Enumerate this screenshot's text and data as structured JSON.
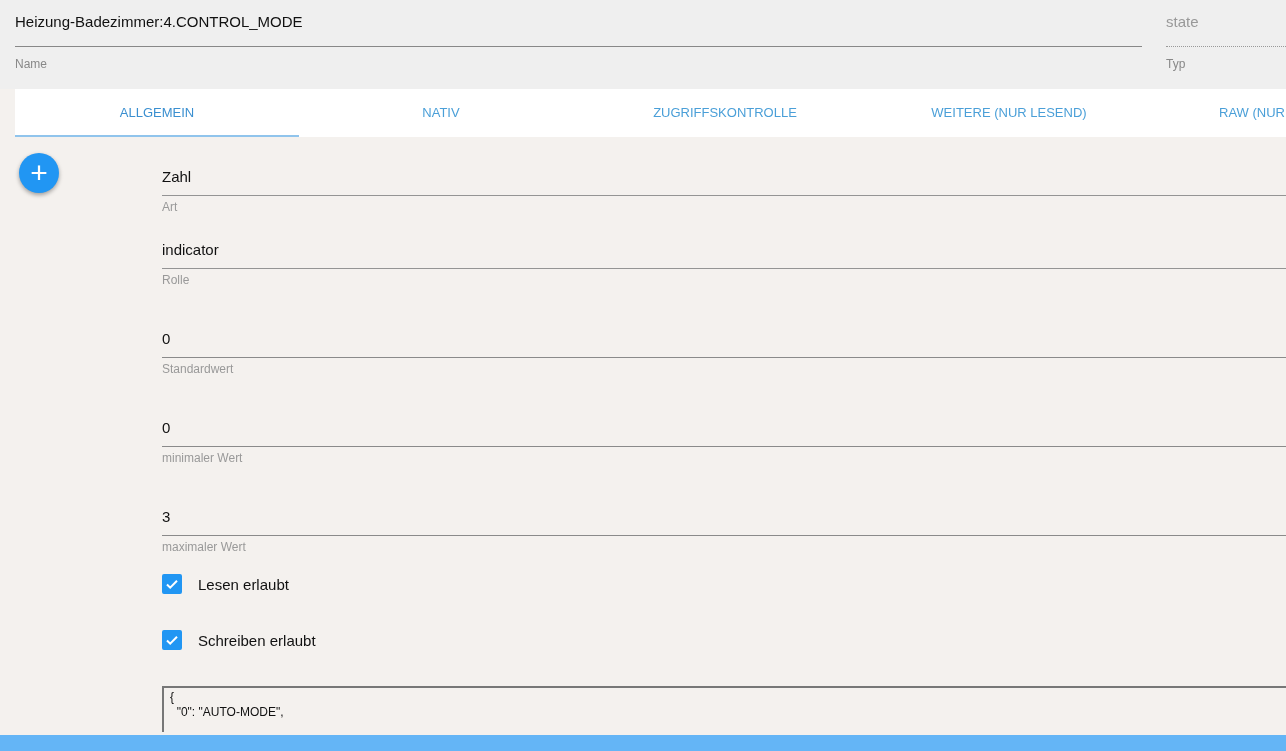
{
  "header": {
    "name": {
      "value": "Heizung-Badezimmer:4.CONTROL_MODE",
      "label": "Name"
    },
    "type": {
      "value": "state",
      "label": "Typ",
      "disabled": true
    }
  },
  "tabs": [
    {
      "label": "ALLGEMEIN",
      "selected": true
    },
    {
      "label": "NATIV",
      "selected": false
    },
    {
      "label": "ZUGRIFFSKONTROLLE",
      "selected": false
    },
    {
      "label": "WEITERE (NUR LESEND)",
      "selected": false
    },
    {
      "label": "RAW (NUR",
      "selected": false
    }
  ],
  "add_button": {
    "label": "+"
  },
  "fields": [
    {
      "kind": "select",
      "value": "Zahl",
      "label": "Art"
    },
    {
      "kind": "input",
      "value": "indicator",
      "label": "Rolle"
    },
    {
      "kind": "number",
      "value": "0",
      "label": "Standardwert"
    },
    {
      "kind": "number",
      "value": "0",
      "label": "minimaler Wert"
    },
    {
      "kind": "number",
      "value": "3",
      "label": "maximaler Wert"
    }
  ],
  "checkboxes": [
    {
      "label": "Lesen erlaubt",
      "checked": true
    },
    {
      "label": "Schreiben erlaubt",
      "checked": true
    }
  ],
  "states_editor": {
    "lines": [
      "{",
      "  \"0\": \"AUTO-MODE\","
    ]
  }
}
